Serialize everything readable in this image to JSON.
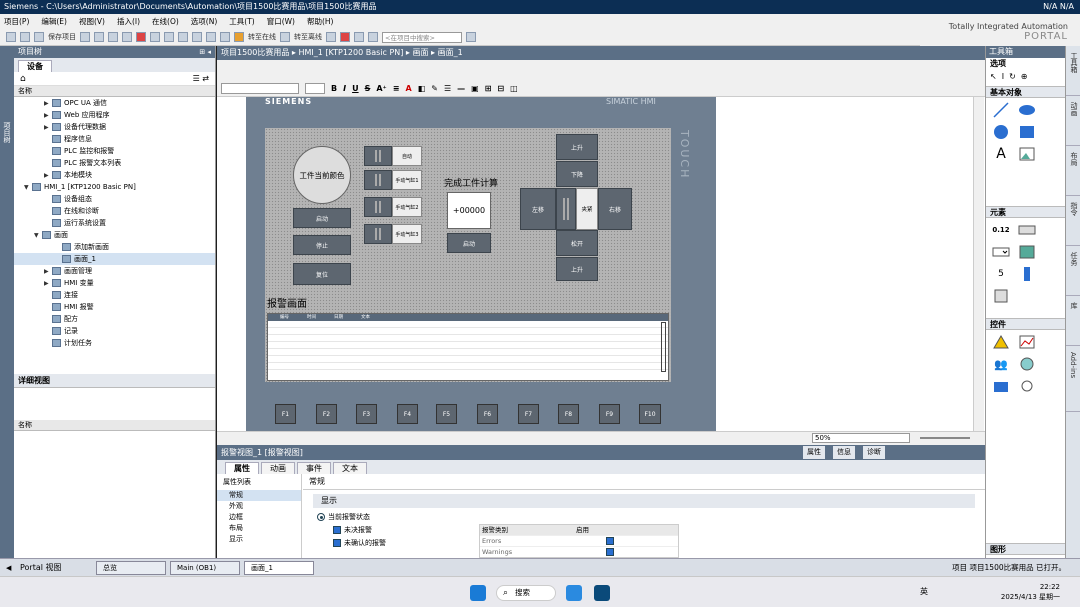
{
  "titlebar": {
    "title": "Siemens  -  C:\\Users\\Administrator\\Documents\\Automation\\项目1500比赛用品\\项目1500比赛用品",
    "right": "N/A   N/A"
  },
  "menu": [
    "项目(P)",
    "编辑(E)",
    "视图(V)",
    "插入(I)",
    "在线(O)",
    "选项(N)",
    "工具(T)",
    "窗口(W)",
    "帮助(H)"
  ],
  "toolbar": {
    "save_project": "保存项目",
    "go_online": "转至在线",
    "go_offline": "转至离线",
    "search_placeholder": "<在项目中搜索>"
  },
  "brand": {
    "line1": "Totally Integrated Automation",
    "line2": "PORTAL"
  },
  "left_strip_label": "项目树",
  "project_tree": {
    "header": "项目树",
    "tab": "设备",
    "col_name": "名称",
    "items": [
      {
        "label": "OPC UA 通信",
        "indent": 3,
        "arrow": "▶"
      },
      {
        "label": "Web 应用程序",
        "indent": 3,
        "arrow": "▶"
      },
      {
        "label": "设备代理数据",
        "indent": 3,
        "arrow": "▶"
      },
      {
        "label": "程序信息",
        "indent": 3,
        "arrow": ""
      },
      {
        "label": "PLC 监控和报警",
        "indent": 3,
        "arrow": ""
      },
      {
        "label": "PLC 报警文本列表",
        "indent": 3,
        "arrow": ""
      },
      {
        "label": "本地模块",
        "indent": 3,
        "arrow": "▶"
      },
      {
        "label": "HMI_1 [KTP1200 Basic PN]",
        "indent": 1,
        "arrow": "▼"
      },
      {
        "label": "设备组态",
        "indent": 3,
        "arrow": ""
      },
      {
        "label": "在线和诊断",
        "indent": 3,
        "arrow": ""
      },
      {
        "label": "运行系统设置",
        "indent": 3,
        "arrow": ""
      },
      {
        "label": "画面",
        "indent": 2,
        "arrow": "▼"
      },
      {
        "label": "添加新画面",
        "indent": 4,
        "arrow": ""
      },
      {
        "label": "画面_1",
        "indent": 4,
        "arrow": "",
        "selected": true
      },
      {
        "label": "画面管理",
        "indent": 3,
        "arrow": "▶"
      },
      {
        "label": "HMI 变量",
        "indent": 3,
        "arrow": "▶"
      },
      {
        "label": "连接",
        "indent": 3,
        "arrow": ""
      },
      {
        "label": "HMI 报警",
        "indent": 3,
        "arrow": ""
      },
      {
        "label": "配方",
        "indent": 3,
        "arrow": ""
      },
      {
        "label": "记录",
        "indent": 3,
        "arrow": ""
      },
      {
        "label": "计划任务",
        "indent": 3,
        "arrow": ""
      }
    ]
  },
  "detail_view": {
    "header": "详细视图",
    "col_name": "名称"
  },
  "breadcrumb": "项目1500比赛用品  ▸  HMI_1 [KTP1200 Basic PN]  ▸  画面  ▸  画面_1",
  "hmi": {
    "brand": "SIEMENS",
    "model": "SIMATIC HMI",
    "touch": "TOUCH",
    "lamp_label": "工件当前颜色",
    "left_buttons": [
      "启动",
      "停止",
      "复位"
    ],
    "switches": [
      "自动",
      "手动气缸1",
      "手动气缸2",
      "手动气缸3"
    ],
    "counter_title": "完成工件计算",
    "counter_value": "+00000",
    "counter_button": "启动",
    "cross_top": [
      "上升",
      "下降"
    ],
    "cross_left": "左移",
    "cross_center": "夹紧",
    "cross_right": "右移",
    "cross_bottom": [
      "松开",
      "上升"
    ],
    "alarm_title": "报警画面",
    "alarm_columns": [
      "编号",
      "时间",
      "日期",
      "文本"
    ],
    "fkeys": [
      "F1",
      "F2",
      "F3",
      "F4",
      "F5",
      "F6",
      "F7",
      "F8",
      "F9",
      "F10"
    ]
  },
  "zoom": "50%",
  "inspector": {
    "header": "报警视图_1 [报警视图]",
    "right_tabs": [
      "属性",
      "信息",
      "诊断"
    ],
    "tabs": [
      "属性",
      "动画",
      "事件",
      "文本"
    ],
    "list_title": "属性列表",
    "list_items": [
      "常规",
      "外观",
      "边框",
      "布局",
      "显示"
    ],
    "group": "常规",
    "section": "显示",
    "radio_label": "当前报警状态",
    "check1": "未决报警",
    "check2": "未确认的报警",
    "table_headers": [
      "报警类别",
      "启用"
    ],
    "table_rows": [
      "Errors",
      "Warnings"
    ]
  },
  "toolbox": {
    "header": "工具箱",
    "select_label": "选项",
    "basic_objects": "基本对象",
    "elements": "元素",
    "controls": "控件",
    "graphics": "图形",
    "element_value": "0.12"
  },
  "right_strip": [
    "工具箱",
    "动画",
    "布局",
    "指令",
    "任务",
    "库",
    "Add-ins"
  ],
  "statusbar": {
    "portal_view": "Portal 视图",
    "buttons": [
      "总览",
      "Main (OB1)",
      "画面_1"
    ],
    "message": "项目 项目1500比赛用品 已打开。"
  },
  "taskbar": {
    "search": "搜索",
    "lang": "英",
    "time": "22:22",
    "date": "2025/4/13 星期一"
  }
}
